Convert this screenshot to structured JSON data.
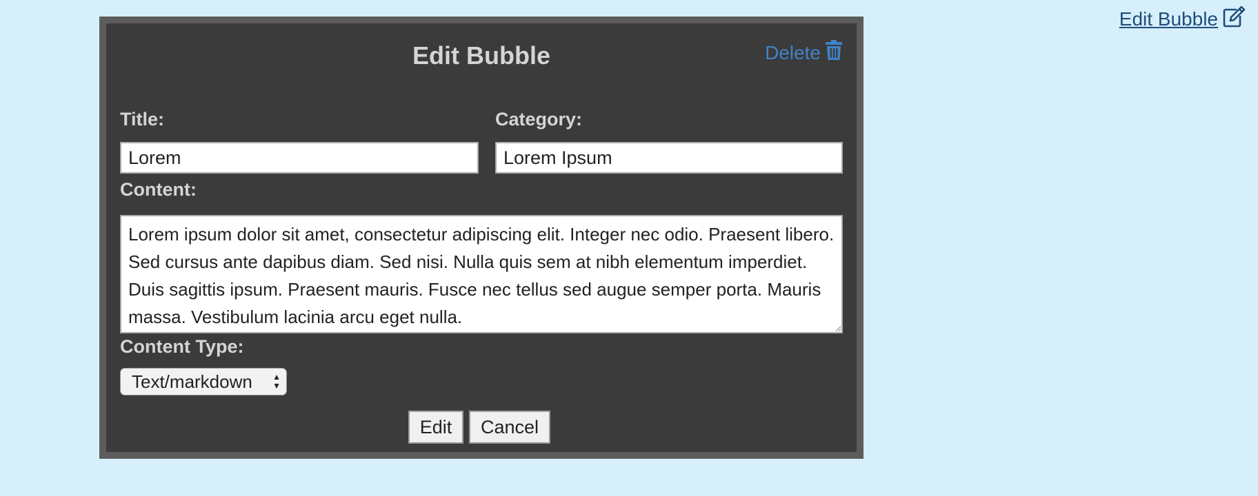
{
  "top_link": {
    "label": "Edit Bubble",
    "icon": "edit-icon"
  },
  "dialog": {
    "title": "Edit Bubble",
    "delete_label": "Delete",
    "delete_icon": "trash-icon",
    "delete_color": "#3f83c8",
    "fields": {
      "title_label": "Title:",
      "title_value": "Lorem",
      "category_label": "Category:",
      "category_value": "Lorem Ipsum",
      "content_label": "Content:",
      "content_value": "Lorem ipsum dolor sit amet, consectetur adipiscing elit. Integer nec odio. Praesent libero. Sed cursus ante dapibus diam. Sed nisi. Nulla quis sem at nibh elementum imperdiet. Duis sagittis ipsum. Praesent mauris. Fusce nec tellus sed augue semper porta. Mauris massa. Vestibulum lacinia arcu eget nulla.",
      "content_type_label": "Content Type:",
      "content_type_value": "Text/markdown"
    },
    "buttons": {
      "edit": "Edit",
      "cancel": "Cancel"
    }
  },
  "colors": {
    "page_background": "#d6effb",
    "dialog_background": "#3b3b3b",
    "dialog_border": "#5c5c5c",
    "link": "#1f4d7a"
  }
}
